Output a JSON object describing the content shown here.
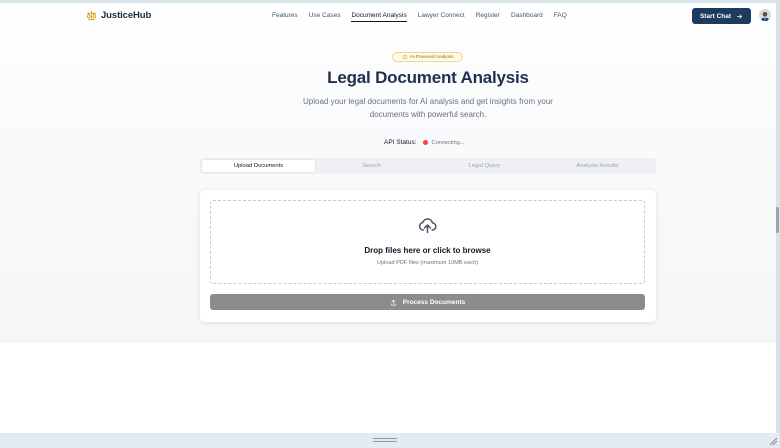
{
  "app": {
    "name": "JusticeHub",
    "logo_icon": "scales-icon"
  },
  "nav": {
    "links": [
      "Features",
      "Use Cases",
      "Document Analysis",
      "Lawyer Connect",
      "Register",
      "Dashboard",
      "FAQ"
    ],
    "active_link": "Document Analysis",
    "cta_label": "Start Chat"
  },
  "hero": {
    "badge": "AI-Powered Analysis",
    "title": "Legal Document Analysis",
    "subtitle": "Upload your legal documents for AI analysis and get insights from your documents with powerful search."
  },
  "api_status": {
    "label": "API Status:",
    "value": "Connecting...",
    "color": "#ef4444"
  },
  "tabs": [
    {
      "label": "Upload Documents",
      "active": true
    },
    {
      "label": "Search",
      "active": false
    },
    {
      "label": "Legal Query",
      "active": false
    },
    {
      "label": "Analysis Results",
      "active": false
    }
  ],
  "upload": {
    "icon": "cloud-upload-icon",
    "title": "Drop files here or click to browse",
    "hint": "Upload PDF files (maximum 10MB each)",
    "button_label": "Process Documents"
  },
  "colors": {
    "brand": "#1e3a5f",
    "accent": "#d4a017",
    "button_disabled": "#8c8c8c"
  }
}
